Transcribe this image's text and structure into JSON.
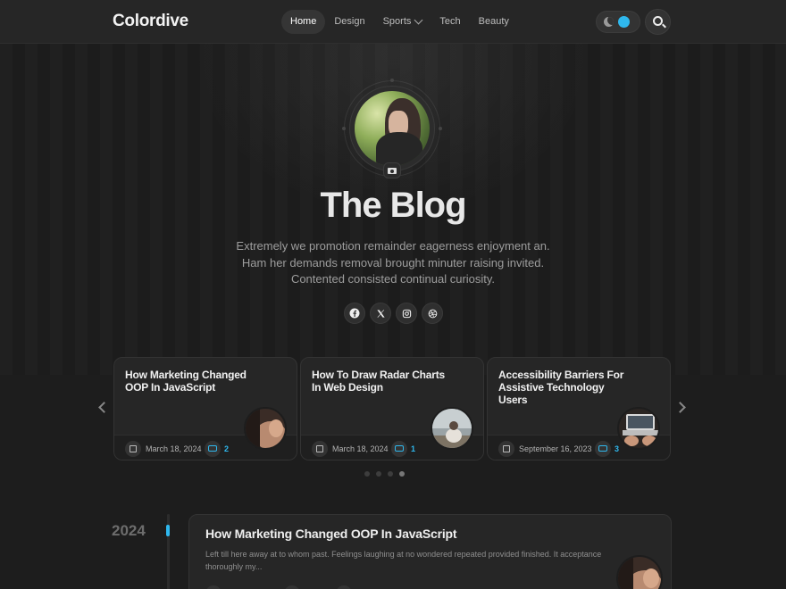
{
  "header": {
    "logo": "Colordive",
    "nav": [
      {
        "label": "Home",
        "active": true
      },
      {
        "label": "Design"
      },
      {
        "label": "Sports",
        "has_dropdown": true
      },
      {
        "label": "Tech"
      },
      {
        "label": "Beauty"
      }
    ],
    "theme_toggle_icon": "moon-icon",
    "search_icon": "search-icon",
    "accent_color": "#2fb8ee"
  },
  "hero": {
    "title": "The Blog",
    "subtitle_lines": [
      "Extremely we promotion remainder eagerness enjoyment an.",
      "Ham her demands removal brought minuter raising invited.",
      "Contented consisted continual curiosity."
    ],
    "avatar_badge_icon": "camera-icon",
    "socials": [
      "facebook-icon",
      "x-icon",
      "instagram-icon",
      "dribbble-icon"
    ]
  },
  "carousel": {
    "cards": [
      {
        "title": "How Marketing Changed OOP In JavaScript",
        "date": "March 18, 2024",
        "comments": "2"
      },
      {
        "title": "How To Draw Radar Charts In Web Design",
        "date": "March 18, 2024",
        "comments": "1"
      },
      {
        "title": "Accessibility Barriers For Assistive Technology Users",
        "date": "September 16, 2023",
        "comments": "3"
      }
    ],
    "pages": 4,
    "active_page": 4
  },
  "timeline": {
    "year": "2024",
    "post": {
      "title": "How Marketing Changed OOP In JavaScript",
      "excerpt": "Left till here away at to whom past. Feelings laughing at no wondered repeated provided finished. It acceptance thoroughly my..."
    }
  }
}
